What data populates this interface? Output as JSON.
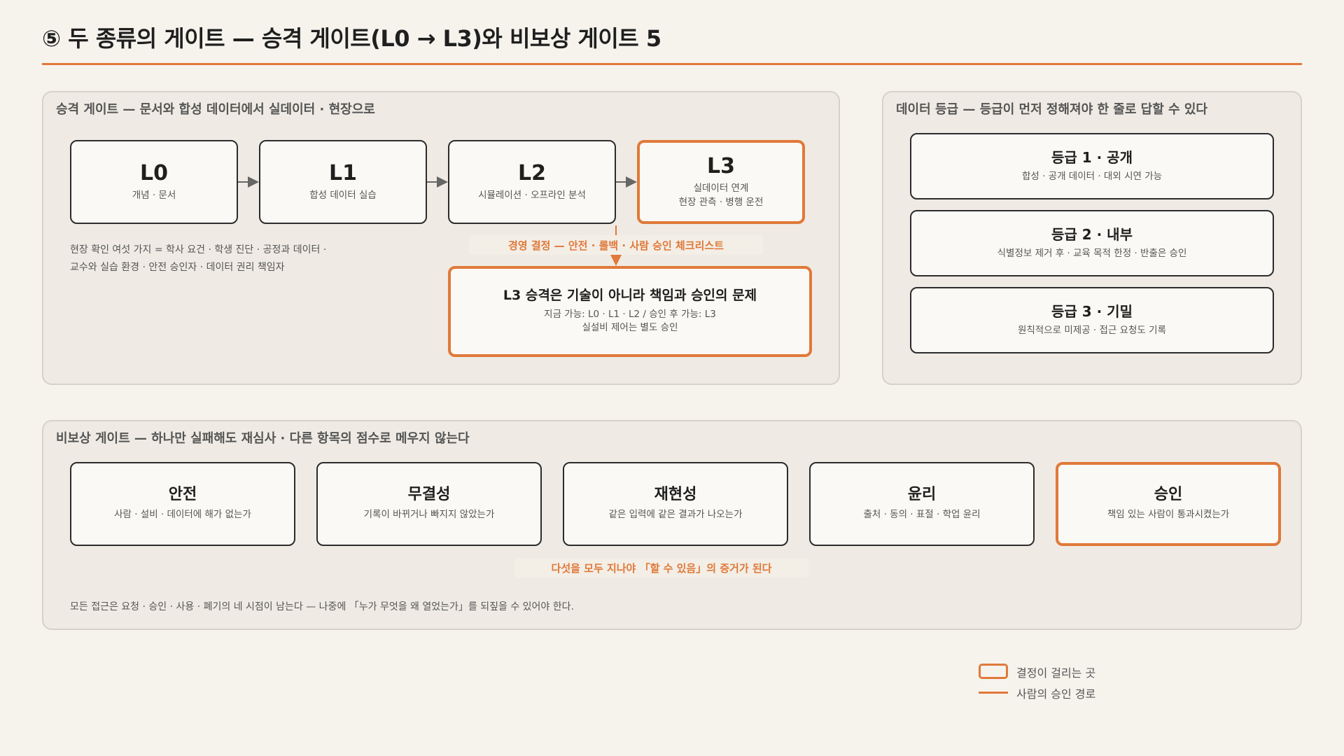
{
  "header": {
    "title": "⑤ 두 종류의 게이트 — 승격 게이트(L0 → L3)와 비보상 게이트 5"
  },
  "promotion_panel": {
    "title": "승격 게이트 — 문서와 합성 데이터에서 실데이터 · 현장으로",
    "stages": [
      {
        "label": "L0",
        "desc": "개념 · 문서",
        "desc2": ""
      },
      {
        "label": "L1",
        "desc": "합성 데이터 실습",
        "desc2": ""
      },
      {
        "label": "L2",
        "desc": "시뮬레이션 · 오프라인 분석",
        "desc2": ""
      },
      {
        "label": "L3",
        "desc": "실데이터 연계",
        "desc2": "현장 관측 · 병행 운전"
      }
    ],
    "field_note_line1": "현장 확인 여섯 가지 = 학사 요건 · 학생 진단 · 공정과 데이터 ·",
    "field_note_line2": "교수와 실습 환경 · 안전 승인자 · 데이터 권리 책임자",
    "decision_tag": "경영 결정 — 안전 · 롤백 · 사람 승인 체크리스트",
    "l3_box": {
      "title": "L3 승격은 기술이 아니라 책임과 승인의 문제",
      "line1": "지금 가능: L0 · L1 · L2 / 승인 후 가능: L3",
      "line2": "실설비 제어는 별도 승인"
    }
  },
  "grade_panel": {
    "title": "데이터 등급 — 등급이 먼저 정해져야 한 줄로 답할 수 있다",
    "grades": [
      {
        "title": "등급 1 · 공개",
        "desc": "합성 · 공개 데이터 · 대외 시연 가능"
      },
      {
        "title": "등급 2 · 내부",
        "desc": "식별정보 제거 후 · 교육 목적 한정 · 반출은 승인"
      },
      {
        "title": "등급 3 · 기밀",
        "desc": "원칙적으로 미제공 · 접근 요청도 기록"
      }
    ]
  },
  "noncomp_panel": {
    "title": "비보상 게이트 — 하나만 실패해도 재심사 · 다른 항목의 점수로 메우지 않는다",
    "gates": [
      {
        "title": "안전",
        "desc": "사람 · 설비 · 데이터에 해가 없는가"
      },
      {
        "title": "무결성",
        "desc": "기록이 바뀌거나 빠지지 않았는가"
      },
      {
        "title": "재현성",
        "desc": "같은 입력에 같은 결과가 나오는가"
      },
      {
        "title": "윤리",
        "desc": "출처 · 동의 · 표절 · 학업 윤리"
      },
      {
        "title": "승인",
        "desc": "책임 있는 사람이 통과시켰는가"
      }
    ],
    "flow_tag": "다섯을 모두 지나야 「할 수 있음」의 증거가 된다",
    "footer_note": "모든 접근은 요청 · 승인 · 사용 · 폐기의 네 시점이 남는다 — 나중에 「누가 무엇을 왜 열었는가」를 되짚을 수 있어야 한다."
  },
  "legend": {
    "decision_point": "결정이 걸리는 곳",
    "approval_path": "사람의 승인 경로"
  },
  "colors": {
    "accent": "#e0793a",
    "border": "#2c2c2c",
    "background": "#f6f3ed",
    "panel": "#efebe4"
  }
}
